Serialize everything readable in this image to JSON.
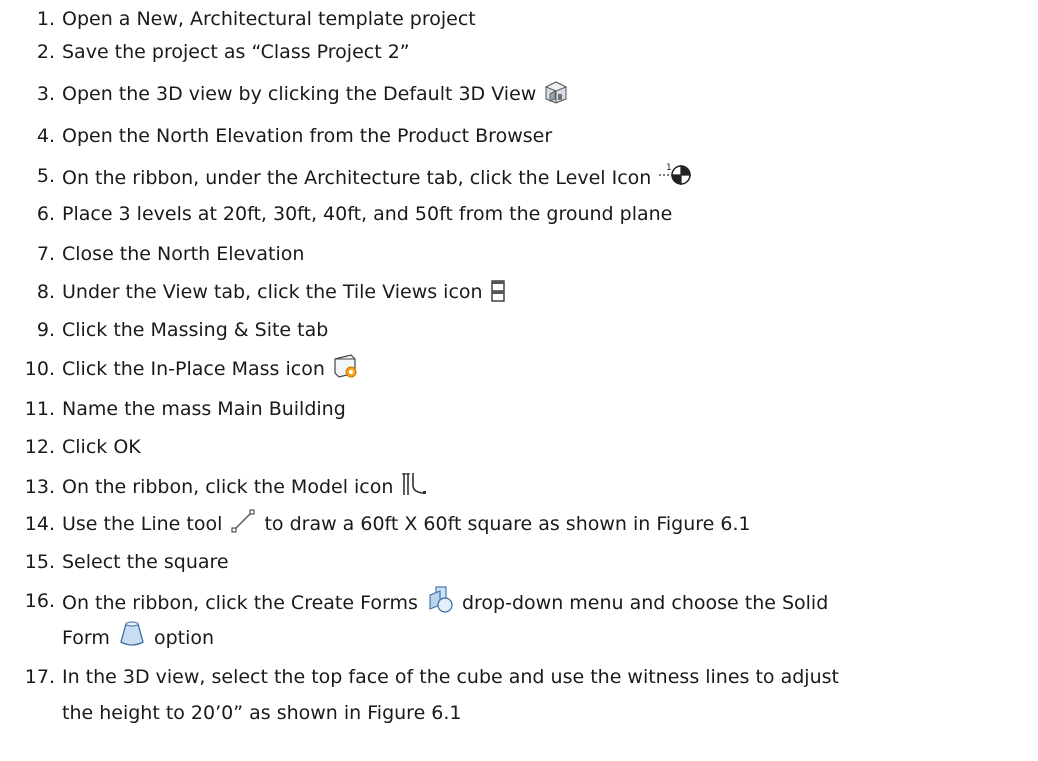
{
  "steps": [
    {
      "num": "1.",
      "text": "Open a New, Architectural template project"
    },
    {
      "num": "2.",
      "text": "Save the project as “Class Project 2”"
    },
    {
      "num": "3.",
      "text": "Open the 3D view by clicking the Default 3D View",
      "icon": "default-3d-view-icon"
    },
    {
      "num": "4.",
      "text": "Open the North Elevation from the Product Browser"
    },
    {
      "num": "5.",
      "text": "On the ribbon, under the Architecture tab, click the Level Icon",
      "icon": "level-icon"
    },
    {
      "num": "6.",
      "text": "Place 3 levels at 20ft, 30ft, 40ft, and 50ft from the ground plane"
    },
    {
      "num": "7.",
      "text": "Close the North Elevation"
    },
    {
      "num": "8.",
      "text": "Under the View tab, click the Tile Views icon",
      "icon": "tile-views-icon"
    },
    {
      "num": "9.",
      "text": "Click the Massing & Site tab"
    },
    {
      "num": "10.",
      "text": "Click the In-Place Mass icon",
      "icon": "in-place-mass-icon"
    },
    {
      "num": "11.",
      "text": "Name the mass Main Building"
    },
    {
      "num": "12.",
      "text": "Click OK"
    },
    {
      "num": "13.",
      "text": "On the ribbon, click the Model icon",
      "icon": "model-icon"
    },
    {
      "num": "14.",
      "text_before": "Use the Line tool",
      "text_after": "to draw a 60ft X 60ft square as shown in Figure 6.1",
      "icon": "line-tool-icon"
    },
    {
      "num": "15.",
      "text": "Select the square"
    },
    {
      "num": "16.",
      "text_before": "On the ribbon, click the Create Forms",
      "text_middle": "drop-down menu and choose the Solid",
      "text_line2_before": "Form",
      "text_line2_after": "option",
      "icon": "create-forms-icon",
      "icon2": "solid-form-icon"
    },
    {
      "num": "17.",
      "text": "In the 3D view, select the top face of the cube and use the witness lines to adjust",
      "text_line2": "the height to 20’0” as shown in Figure 6.1"
    }
  ]
}
